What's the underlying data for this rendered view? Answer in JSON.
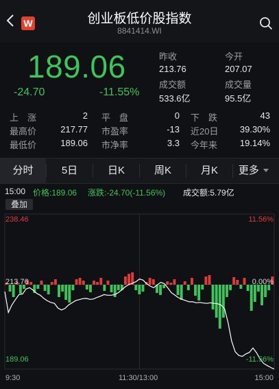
{
  "header": {
    "title": "创业板低价股指数",
    "code": "8841414.WI",
    "logo_text": "W",
    "back_icon": "chevron-left-icon",
    "search_icon": "search-icon"
  },
  "quote": {
    "price": "189.06",
    "change": "-24.70",
    "change_pct": "-11.55%",
    "stats": [
      {
        "label": "昨收",
        "value": "213.76"
      },
      {
        "label": "今开",
        "value": "207.07"
      },
      {
        "label": "成交额",
        "value": "533.6亿"
      },
      {
        "label": "成交量",
        "value": "95.5亿"
      }
    ]
  },
  "market": {
    "rows": [
      [
        {
          "label": "上　涨",
          "value": "2"
        },
        {
          "label": "平　盘",
          "value": "0"
        },
        {
          "label": "下　跌",
          "value": "43"
        }
      ],
      [
        {
          "label": "最高价",
          "value": "217.77"
        },
        {
          "label": "市盈率",
          "value": "-13"
        },
        {
          "label": "近20日",
          "value": "39.30%"
        }
      ],
      [
        {
          "label": "最低价",
          "value": "189.06"
        },
        {
          "label": "市净率",
          "value": "3.3"
        },
        {
          "label": "今年来",
          "value": "19.14%"
        }
      ]
    ]
  },
  "tabs": [
    "分时",
    "5日",
    "日K",
    "周K",
    "月K",
    "更多"
  ],
  "active_tab": 0,
  "chart_info": {
    "time": "15:00",
    "price": "价格:189.06",
    "change": "涨跌:-24.70(-11.56%)",
    "volume": "成交额:5.79亿",
    "overlay_button": "叠加"
  },
  "colors": {
    "up": "#e03b3b",
    "down": "#3ec45a",
    "line": "#ffffff",
    "background": "#101114"
  },
  "chart_data": {
    "type": "line",
    "y_labels_left": [
      "238.46",
      "213.76",
      "189.06"
    ],
    "y_labels_right": [
      "11.56%",
      "0.00%",
      "-11.56%"
    ],
    "x_labels": [
      "9:30",
      "11:30/13:00",
      "15:00"
    ],
    "ylim": [
      189.06,
      238.46
    ],
    "prev_close": 213.76,
    "price": [
      213.76,
      207.1,
      209.5,
      211.2,
      212.8,
      213.0,
      214.6,
      215.0,
      214.2,
      213.2,
      212.6,
      211.6,
      210.8,
      210.3,
      210.0,
      208.5,
      207.9,
      208.4,
      209.5,
      210.2,
      210.9,
      211.2,
      211.5,
      211.6,
      211.3,
      211.4,
      211.9,
      212.3,
      212.8,
      212.6,
      212.6,
      212.8,
      213.4,
      214.3,
      215.3,
      216.0,
      216.4,
      216.9,
      217.77,
      217.4,
      216.3,
      215.5,
      215.0,
      215.9,
      216.7,
      216.3,
      214.9,
      213.4,
      212.6,
      211.8,
      211.3,
      210.9,
      210.5,
      210.5,
      210.2,
      210.3,
      210.1,
      210.0,
      210.2,
      210.0,
      209.9,
      209.5,
      208.3,
      203.8,
      198.0,
      194.6,
      193.4,
      193.1,
      193.9,
      194.4,
      195.8,
      194.3,
      192.3,
      190.9,
      190.2,
      189.6,
      189.06
    ],
    "volume_bars": [
      3,
      -10,
      -18,
      4,
      -13,
      -6,
      7,
      4,
      -12,
      -6,
      6,
      -9,
      -14,
      4,
      8,
      -18,
      -10,
      -22,
      -26,
      -8,
      8,
      10,
      6,
      -7,
      -11,
      6,
      4,
      10,
      -9,
      6,
      -11,
      -18,
      -8,
      -8,
      12,
      16,
      18,
      -8,
      -14,
      -10,
      4,
      10,
      8,
      -12,
      -15,
      -5,
      5,
      3,
      8,
      -15,
      -22,
      5,
      -8,
      10,
      -16,
      -23,
      -7,
      12,
      14,
      -36,
      -48,
      -64,
      -48,
      -18,
      -8,
      11,
      7,
      -6,
      10,
      -9,
      -38,
      -25,
      -10,
      -30,
      -18,
      -8,
      12
    ]
  }
}
